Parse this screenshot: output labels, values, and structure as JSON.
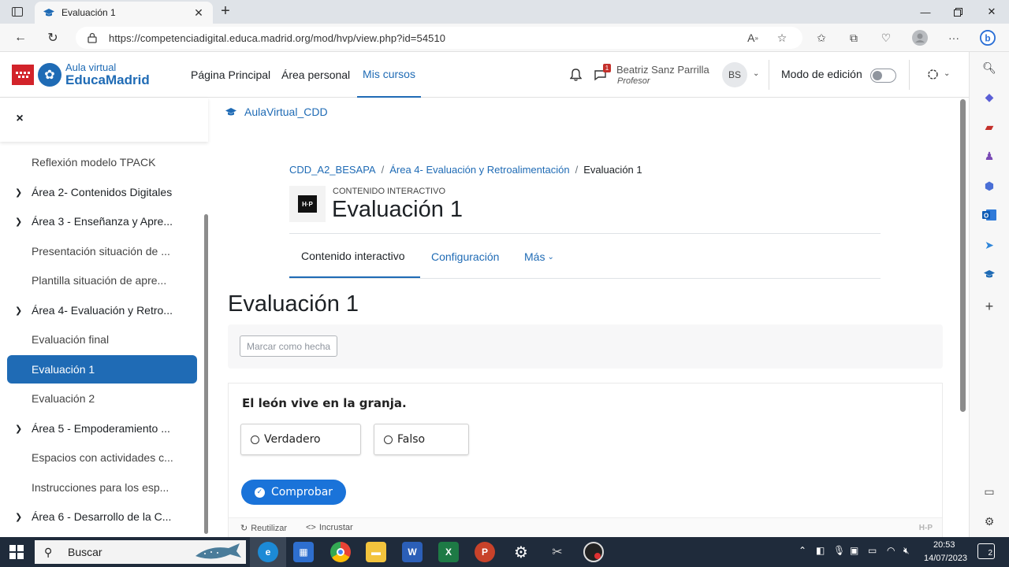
{
  "browser": {
    "tab_title": "Evaluación 1",
    "url": "https://competenciadigital.educa.madrid.org/mod/hvp/view.php?id=54510",
    "tab_close": "✕",
    "new_tab": "+"
  },
  "header": {
    "logo_small": "Aula virtual",
    "logo_big": "EducaMadrid",
    "nav": [
      "Página Principal",
      "Área personal",
      "Mis cursos"
    ],
    "messages_count": "1",
    "user_name": "Beatriz Sanz Parrilla",
    "user_role": "Profesor",
    "avatar_initials": "BS",
    "edit_mode_label": "Modo de edición"
  },
  "drawer": {
    "close": "×",
    "items": [
      {
        "label": "Reflexión modelo TPACK",
        "type": "sub"
      },
      {
        "label": "Área 2- Contenidos Digitales",
        "type": "section"
      },
      {
        "label": "Área 3 - Enseñanza y Apre...",
        "type": "section"
      },
      {
        "label": "Presentación situación de ...",
        "type": "sub"
      },
      {
        "label": "Plantilla situación de apre...",
        "type": "sub"
      },
      {
        "label": "Área 4- Evaluación y Retro...",
        "type": "section"
      },
      {
        "label": "Evaluación final",
        "type": "sub"
      },
      {
        "label": "Evaluación 1",
        "type": "sub",
        "active": true
      },
      {
        "label": "Evaluación 2",
        "type": "sub"
      },
      {
        "label": "Área 5 - Empoderamiento ...",
        "type": "section"
      },
      {
        "label": "Espacios con actividades c...",
        "type": "sub"
      },
      {
        "label": "Instrucciones para los esp...",
        "type": "sub"
      },
      {
        "label": "Área 6 - Desarrollo de la C...",
        "type": "section"
      }
    ]
  },
  "main": {
    "course_link": "AulaVirtual_CDD",
    "breadcrumb": [
      "CDD_A2_BESAPA",
      "Área 4- Evaluación y Retroalimentación",
      "Evaluación 1"
    ],
    "activity_type": "CONTENIDO INTERACTIVO",
    "activity_title": "Evaluación 1",
    "tabs": [
      "Contenido interactivo",
      "Configuración",
      "Más"
    ],
    "page_heading": "Evaluación 1",
    "mark_done": "Marcar como hecha",
    "h5p": {
      "question": "El león vive en la granja.",
      "options": [
        "Verdadero",
        "Falso"
      ],
      "check_button": "Comprobar",
      "footer_reuse": "Reutilizar",
      "footer_embed": "Incrustar",
      "brand": "H-P"
    }
  },
  "taskbar": {
    "search": "Buscar",
    "time": "20:53",
    "date": "14/07/2023",
    "notifications": "2"
  },
  "colors": {
    "accent": "#1f6bb5",
    "h5p_button": "#1a73d9",
    "taskbar": "#1f2b3b"
  }
}
